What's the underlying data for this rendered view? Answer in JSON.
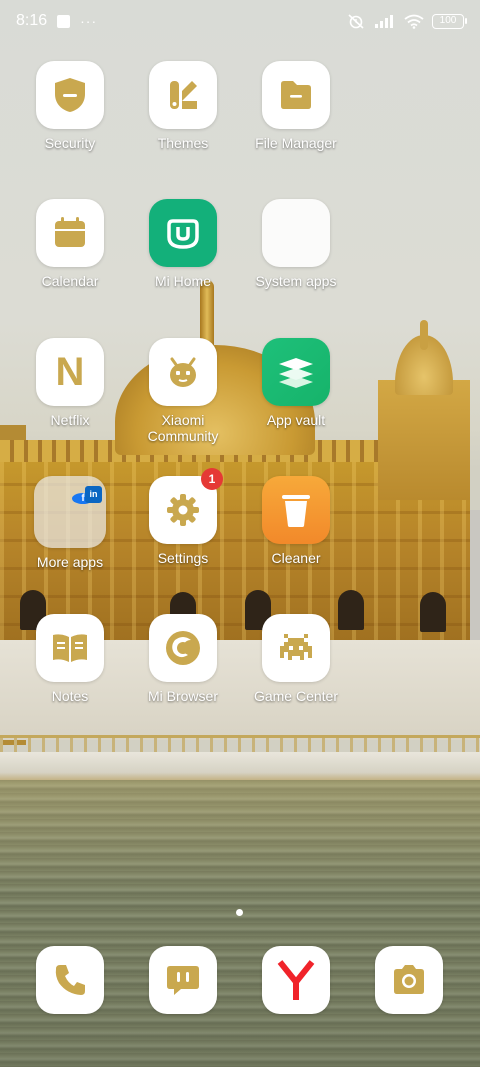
{
  "status_bar": {
    "time": "8:16",
    "dots": "···",
    "battery": "100"
  },
  "apps": {
    "security": "Security",
    "themes": "Themes",
    "file_manager": "File Manager",
    "calendar": "Calendar",
    "mi_home": "Mi Home",
    "system_apps": "System apps",
    "netflix": "Netflix",
    "netflix_letter": "N",
    "xiaomi_community_line1": "Xiaomi",
    "xiaomi_community_line2": "Community",
    "app_vault": "App vault",
    "more_apps": "More apps",
    "settings": "Settings",
    "settings_badge": "1",
    "cleaner": "Cleaner",
    "notes": "Notes",
    "mi_browser": "Mi Browser",
    "game_center": "Game Center"
  },
  "more_apps_folder": {
    "facebook": "f",
    "linkedin": "in"
  },
  "colors": {
    "icon_gold": "#c9a84f",
    "mi_home_green": "#13b07a",
    "app_vault_green": "#23c16b",
    "cleaner_orange": "#f59a28",
    "badge_red": "#e53935",
    "browser_red": "#f0232a"
  },
  "dock": [
    "phone-icon",
    "messages-icon",
    "browser-y-icon",
    "camera-icon"
  ]
}
